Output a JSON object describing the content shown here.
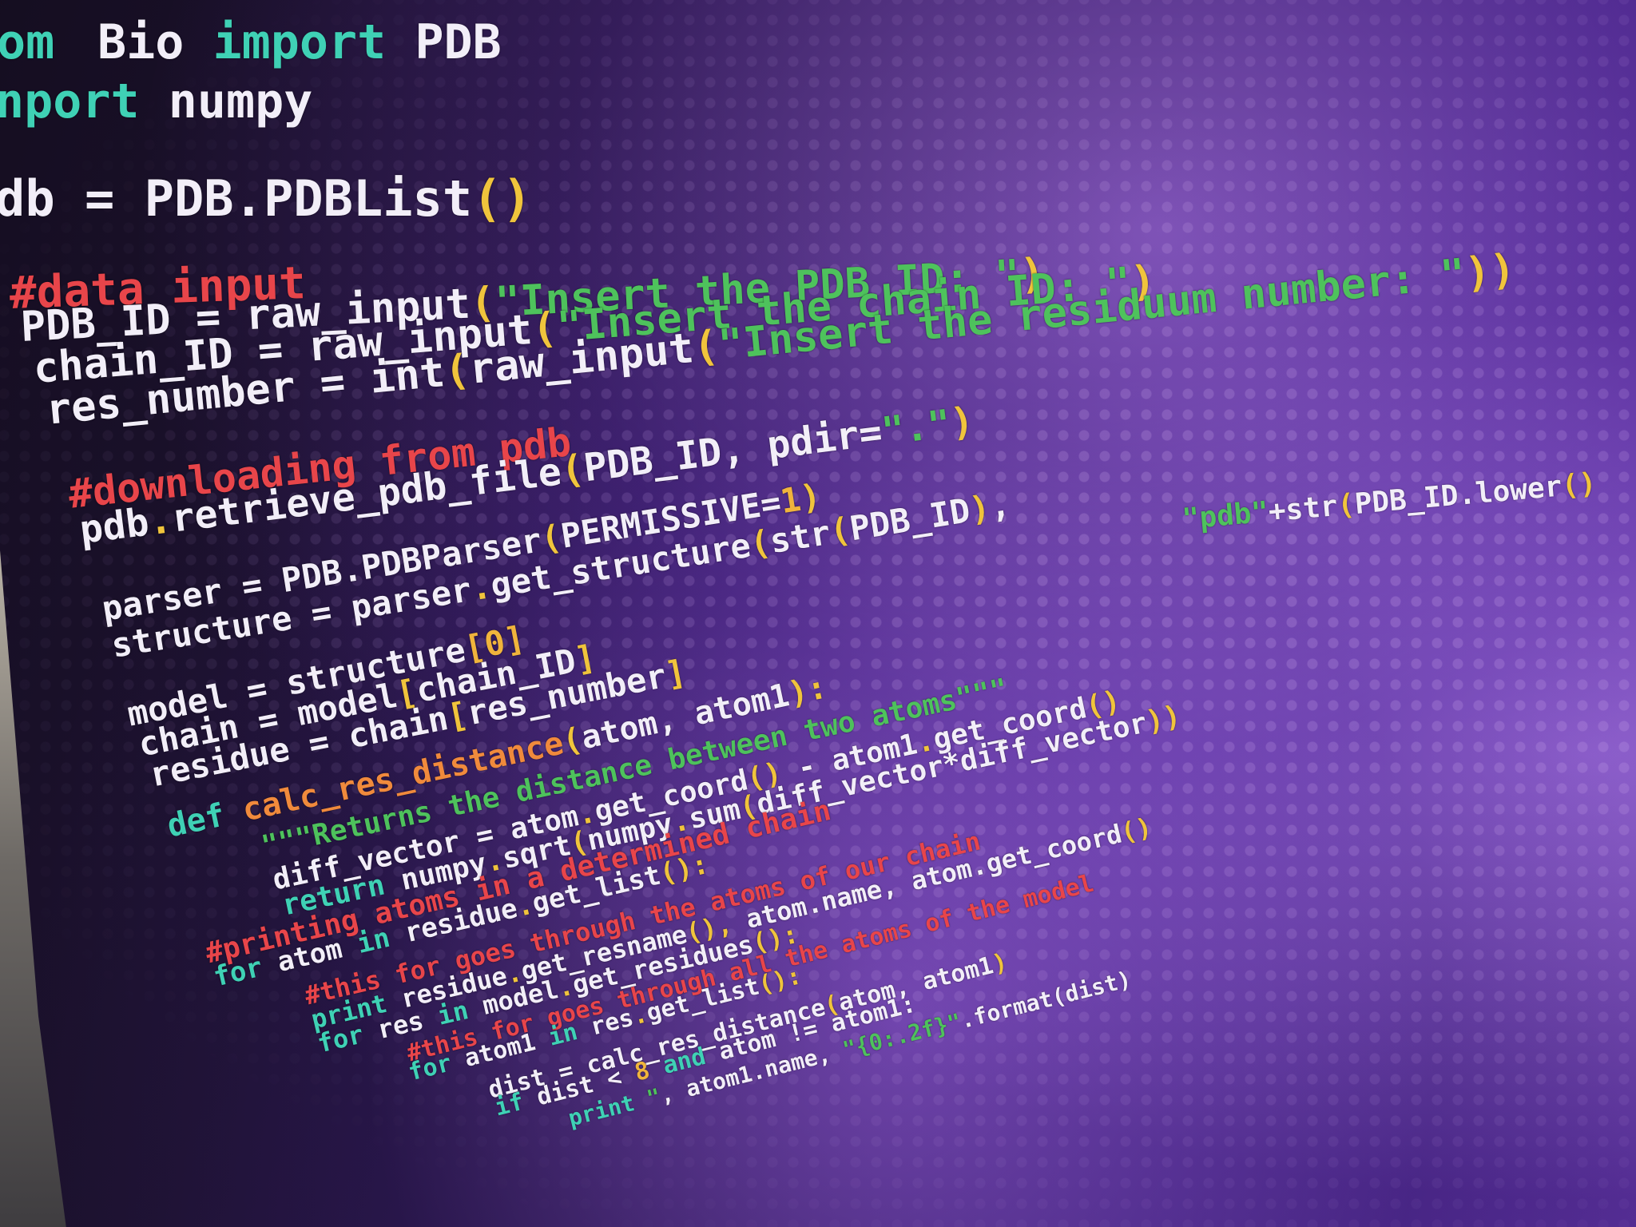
{
  "code": {
    "l1": [
      [
        "Bio ",
        "plain"
      ],
      [
        "import",
        "kw"
      ],
      [
        " PDB",
        "plain"
      ]
    ],
    "l1a": [
      [
        "om ",
        "kw"
      ]
    ],
    "l2": [
      [
        "nport",
        "kw"
      ],
      [
        " numpy",
        "plain"
      ]
    ],
    "l3": [
      [
        "db = PDB.PDBList",
        "plain"
      ],
      [
        "()",
        "pun"
      ]
    ],
    "l4": [
      [
        "#data input",
        "cm"
      ]
    ],
    "l5": [
      [
        "PDB_ID = raw_input",
        "plain"
      ],
      [
        "(",
        "pun"
      ],
      [
        "\"Insert the PDB ID: \"",
        "str"
      ],
      [
        ")",
        "pun"
      ]
    ],
    "l6": [
      [
        "chain_ID = raw_input",
        "plain"
      ],
      [
        "(",
        "pun"
      ],
      [
        "\"Insert the chain ID: \"",
        "str"
      ],
      [
        ")",
        "pun"
      ]
    ],
    "l7": [
      [
        "res_number = int",
        "plain"
      ],
      [
        "(",
        "pun"
      ],
      [
        "raw_input",
        "plain"
      ],
      [
        "(",
        "pun"
      ],
      [
        "\"Insert the residuum number: \"",
        "str"
      ],
      [
        "))",
        "pun"
      ]
    ],
    "l8": [
      [
        "#downloading from pdb",
        "cm"
      ]
    ],
    "l9": [
      [
        "pdb",
        "plain"
      ],
      [
        ".",
        "pun"
      ],
      [
        "retrieve_pdb_file",
        "plain"
      ],
      [
        "(",
        "pun"
      ],
      [
        "PDB_ID, pdir=",
        "plain"
      ],
      [
        "\".\"",
        "str"
      ],
      [
        ")",
        "pun"
      ]
    ],
    "l9b": [
      [
        "\"pdb\"",
        "str"
      ],
      [
        "+str",
        "plain"
      ],
      [
        "(",
        "pun"
      ],
      [
        "PDB_ID.lower",
        "plain"
      ],
      [
        "()",
        "pun"
      ]
    ],
    "l10": [
      [
        "parser = PDB.PDBParser",
        "plain"
      ],
      [
        "(",
        "pun"
      ],
      [
        "PERMISSIVE=",
        "plain"
      ],
      [
        "1",
        "num"
      ],
      [
        ")",
        "pun"
      ]
    ],
    "l11": [
      [
        "structure = parser",
        "plain"
      ],
      [
        ".",
        "pun"
      ],
      [
        "get_structure",
        "plain"
      ],
      [
        "(",
        "pun"
      ],
      [
        "str",
        "plain"
      ],
      [
        "(",
        "pun"
      ],
      [
        "PDB_ID",
        "plain"
      ],
      [
        ")",
        "pun"
      ],
      [
        ", ",
        "plain"
      ]
    ],
    "l12": [
      [
        "model = structure",
        "plain"
      ],
      [
        "[0]",
        "num"
      ]
    ],
    "l13": [
      [
        "chain = model",
        "plain"
      ],
      [
        "[",
        "pun"
      ],
      [
        "chain_ID",
        "plain"
      ],
      [
        "]",
        "pun"
      ]
    ],
    "l14": [
      [
        "residue = chain",
        "plain"
      ],
      [
        "[",
        "pun"
      ],
      [
        "res_number",
        "plain"
      ],
      [
        "]",
        "pun"
      ]
    ],
    "l15": [
      [
        "def ",
        "kw"
      ],
      [
        "calc_res_distance",
        "fn"
      ],
      [
        "(",
        "pun"
      ],
      [
        "atom, atom1",
        "plain"
      ],
      [
        "):",
        "pun"
      ]
    ],
    "l16": [
      [
        "\"\"\"Returns the distance between two atoms\"\"\"",
        "str"
      ]
    ],
    "l17": [
      [
        "diff_vector = atom",
        "plain"
      ],
      [
        ".",
        "pun"
      ],
      [
        "get_coord",
        "plain"
      ],
      [
        "()",
        "pun"
      ],
      [
        " - atom1",
        "plain"
      ],
      [
        ".",
        "pun"
      ],
      [
        "get_coord",
        "plain"
      ],
      [
        "()",
        "pun"
      ]
    ],
    "l18": [
      [
        "return ",
        "kw"
      ],
      [
        "numpy",
        "plain"
      ],
      [
        ".",
        "pun"
      ],
      [
        "sqrt",
        "plain"
      ],
      [
        "(",
        "pun"
      ],
      [
        "numpy",
        "plain"
      ],
      [
        ".",
        "pun"
      ],
      [
        "sum",
        "plain"
      ],
      [
        "(",
        "pun"
      ],
      [
        "diff_vector*diff_vector",
        "plain"
      ],
      [
        "))",
        "pun"
      ]
    ],
    "l19": [
      [
        "#printing atoms in a determined chain",
        "cm"
      ]
    ],
    "l20": [
      [
        "for ",
        "kw"
      ],
      [
        "atom ",
        "plain"
      ],
      [
        "in ",
        "kw"
      ],
      [
        "residue",
        "plain"
      ],
      [
        ".",
        "pun"
      ],
      [
        "get_list",
        "plain"
      ],
      [
        "():",
        "pun"
      ]
    ],
    "l21": [
      [
        "#this for goes through the atoms of our chain",
        "cm"
      ]
    ],
    "l22": [
      [
        "print ",
        "kw"
      ],
      [
        "residue",
        "plain"
      ],
      [
        ".",
        "pun"
      ],
      [
        "get_resname",
        "plain"
      ],
      [
        "(),",
        "pun"
      ],
      [
        " atom.name, atom.get_coord",
        "plain"
      ],
      [
        "()",
        "pun"
      ]
    ],
    "l23": [
      [
        "for ",
        "kw"
      ],
      [
        "res ",
        "plain"
      ],
      [
        "in ",
        "kw"
      ],
      [
        "model",
        "plain"
      ],
      [
        ".",
        "pun"
      ],
      [
        "get_residues",
        "plain"
      ],
      [
        "():",
        "pun"
      ]
    ],
    "l24": [
      [
        "#this for goes through all the atoms of the model",
        "cm"
      ]
    ],
    "l25": [
      [
        "for ",
        "kw"
      ],
      [
        "atom1 ",
        "plain"
      ],
      [
        "in ",
        "kw"
      ],
      [
        "res",
        "plain"
      ],
      [
        ".",
        "pun"
      ],
      [
        "get_list",
        "plain"
      ],
      [
        "():",
        "pun"
      ]
    ],
    "l26": [
      [
        "dist = calc_res_distance",
        "plain"
      ],
      [
        "(",
        "pun"
      ],
      [
        "atom, atom1",
        "plain"
      ],
      [
        ")",
        "pun"
      ]
    ],
    "l27": [
      [
        "if ",
        "kw"
      ],
      [
        "dist < ",
        "plain"
      ],
      [
        "8 ",
        "num"
      ],
      [
        "and ",
        "kw"
      ],
      [
        "atom != atom1:",
        "plain"
      ]
    ],
    "l28": [
      [
        "print ",
        "kw"
      ],
      [
        "\"",
        "str"
      ],
      [
        ", atom1.name, ",
        "plain"
      ],
      [
        "\"{0:.2f}\"",
        "str"
      ],
      [
        ".format(dist)",
        "plain"
      ]
    ]
  },
  "colors": {
    "keyword": "#3fd1b5",
    "string": "#4ec25c",
    "comment": "#e8454a",
    "function": "#f08a3c",
    "number": "#f0b43c",
    "text": "#f2eef8"
  }
}
